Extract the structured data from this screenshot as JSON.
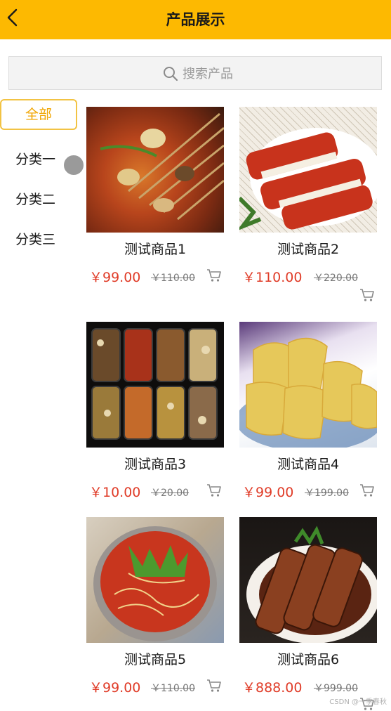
{
  "header": {
    "title": "产品展示",
    "back_icon": "chevron-left-icon"
  },
  "search": {
    "placeholder": "搜索产品",
    "icon": "search-icon"
  },
  "categories": [
    {
      "label": "全部",
      "active": true
    },
    {
      "label": "分类一"
    },
    {
      "label": "分类二"
    },
    {
      "label": "分类三"
    }
  ],
  "products": [
    {
      "name": "测试商品1",
      "price": "￥99.00",
      "original_price": "￥110.00",
      "image": "spicy-skewers-pot"
    },
    {
      "name": "测试商品2",
      "price": "￥110.00",
      "original_price": "￥220.00",
      "image": "roast-pork-slices"
    },
    {
      "name": "测试商品3",
      "price": "￥10.00",
      "original_price": "￥20.00",
      "image": "bento-box-dishes"
    },
    {
      "name": "测试商品4",
      "price": "￥99.00",
      "original_price": "￥199.00",
      "image": "white-cut-chicken"
    },
    {
      "name": "测试商品5",
      "price": "￥99.00",
      "original_price": "￥110.00",
      "image": "spicy-noodle-bowl"
    },
    {
      "name": "测试商品6",
      "price": "￥888.00",
      "original_price": "￥999.00",
      "image": "braised-pork-belly"
    }
  ],
  "colors": {
    "accent": "#fdb901",
    "price": "#e03c28",
    "category_active": "#f0a500"
  },
  "watermark": "CSDN @一季春秋"
}
